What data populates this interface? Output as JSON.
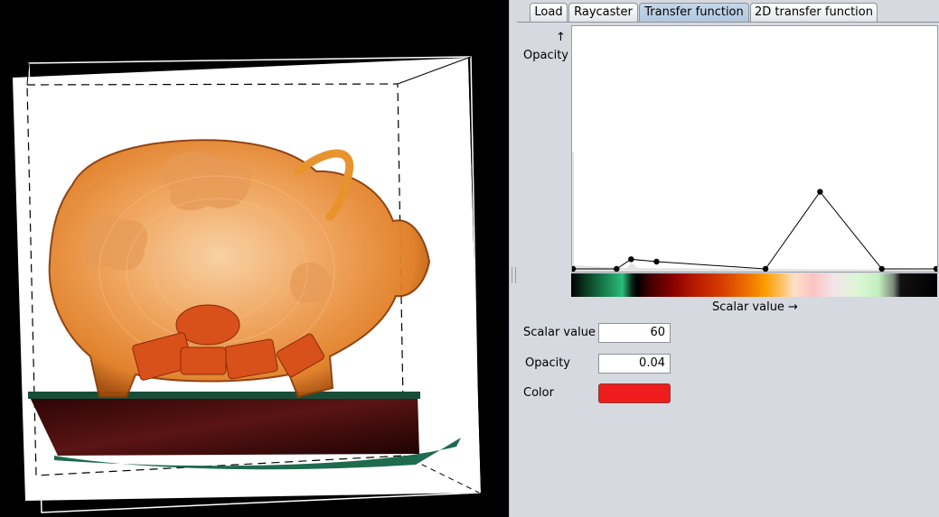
{
  "tabs": [
    {
      "label": "Load",
      "active": false
    },
    {
      "label": "Raycaster",
      "active": false
    },
    {
      "label": "Transfer function",
      "active": true
    },
    {
      "label": "2D transfer function",
      "active": false
    }
  ],
  "transfer_function": {
    "y_axis_arrow": "↑",
    "y_axis_label": "Opacity",
    "x_axis_label": "Scalar value →",
    "control_points": [
      {
        "scalar": 0,
        "opacity": 0.0
      },
      {
        "scalar": 12,
        "opacity": 0.0
      },
      {
        "scalar": 16,
        "opacity": 0.04
      },
      {
        "scalar": 23,
        "opacity": 0.03
      },
      {
        "scalar": 53,
        "opacity": 0.0
      },
      {
        "scalar": 68,
        "opacity": 0.32
      },
      {
        "scalar": 85,
        "opacity": 0.0
      },
      {
        "scalar": 100,
        "opacity": 0.0
      }
    ],
    "scalar_range": [
      0,
      100
    ],
    "opacity_range": [
      0,
      1
    ]
  },
  "controls": {
    "scalar_value_label": "Scalar value",
    "scalar_value": "60",
    "opacity_label": "Opacity",
    "opacity_value": "0.04",
    "color_label": "Color",
    "color_value": "#ee1c1c"
  },
  "viewport": {
    "object_colors": {
      "glass": "#e58a2c",
      "base": "#3b0a0a",
      "background": "#000000"
    }
  }
}
